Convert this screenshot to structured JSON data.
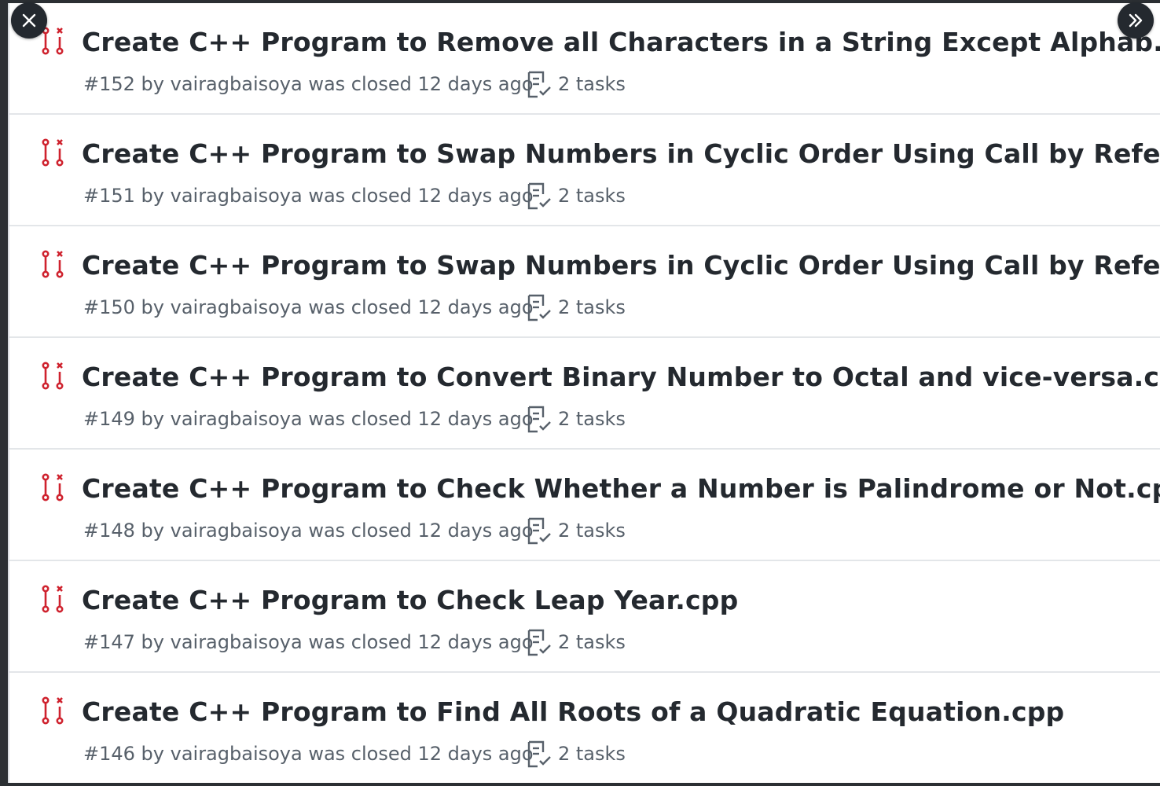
{
  "colors": {
    "closed_pr": "#cf222e",
    "title": "#24292f",
    "meta": "#57606a",
    "divider": "#e3e6e9"
  },
  "controls": {
    "close_icon": "close-icon",
    "next_icon": "double-chevron-right-icon"
  },
  "pull_requests": [
    {
      "title": "Create C++ Program to Remove all Characters in a String Except Alphab...",
      "meta": "#152 by vairagbaisoya was closed 12 days ago",
      "tasks": "2 tasks"
    },
    {
      "title": "Create C++ Program to Swap Numbers in Cyclic Order Using Call by Refe...",
      "meta": "#151 by vairagbaisoya was closed 12 days ago",
      "tasks": "2 tasks"
    },
    {
      "title": "Create C++ Program to Swap Numbers in Cyclic Order Using Call by Refe...",
      "meta": "#150 by vairagbaisoya was closed 12 days ago",
      "tasks": "2 tasks"
    },
    {
      "title": "Create C++ Program to Convert Binary Number to Octal and vice-versa.cpp",
      "meta": "#149 by vairagbaisoya was closed 12 days ago",
      "tasks": "2 tasks"
    },
    {
      "title": "Create C++ Program to Check Whether a Number is Palindrome or Not.cpp",
      "meta": "#148 by vairagbaisoya was closed 12 days ago",
      "tasks": "2 tasks"
    },
    {
      "title": "Create C++ Program to Check Leap Year.cpp",
      "meta": "#147 by vairagbaisoya was closed 12 days ago",
      "tasks": "2 tasks"
    },
    {
      "title": "Create C++ Program to Find All Roots of a Quadratic Equation.cpp",
      "meta": "#146 by vairagbaisoya was closed 12 days ago",
      "tasks": "2 tasks"
    }
  ]
}
